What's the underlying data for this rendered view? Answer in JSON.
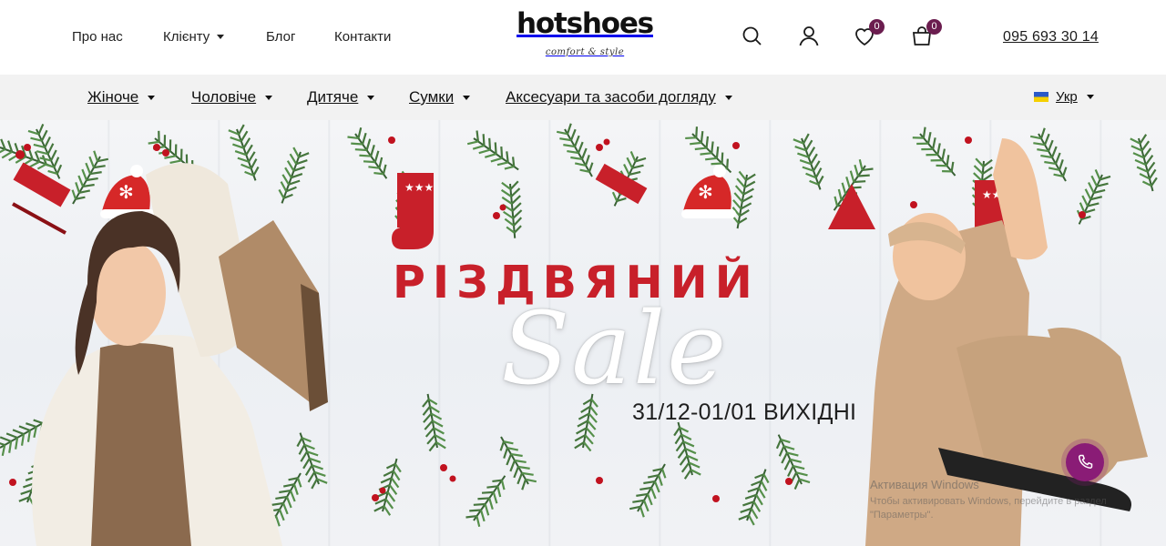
{
  "header": {
    "nav": [
      {
        "label": "Про нас"
      },
      {
        "label": "Клієнту"
      },
      {
        "label": "Блог"
      },
      {
        "label": "Контакти"
      }
    ],
    "logo": {
      "main": "hotshoes",
      "tagline": "comfort & style"
    },
    "wishlist_count": "0",
    "cart_count": "0",
    "phone": "095 693 30 14",
    "icons": [
      "search-icon",
      "user-icon",
      "heart-icon",
      "cart-icon"
    ]
  },
  "categories": [
    {
      "label": "Жіноче"
    },
    {
      "label": "Чоловіче"
    },
    {
      "label": "Дитяче"
    },
    {
      "label": "Сумки"
    },
    {
      "label": "Аксесуари та засоби догляду"
    }
  ],
  "language": {
    "label": "Укр"
  },
  "hero": {
    "headline": "РІЗДВЯНИЙ",
    "script": "Sale",
    "dates": "31/12-01/01 ВИХІДНІ"
  },
  "windows_watermark": {
    "title": "Активация Windows",
    "text": "Чтобы активировать Windows, перейдите в раздел \"Параметры\"."
  },
  "colors": {
    "accent": "#6b1d4f",
    "headline": "#c8202a",
    "call_button": "#8a1c76",
    "category_bar": "#f2f2f2"
  }
}
